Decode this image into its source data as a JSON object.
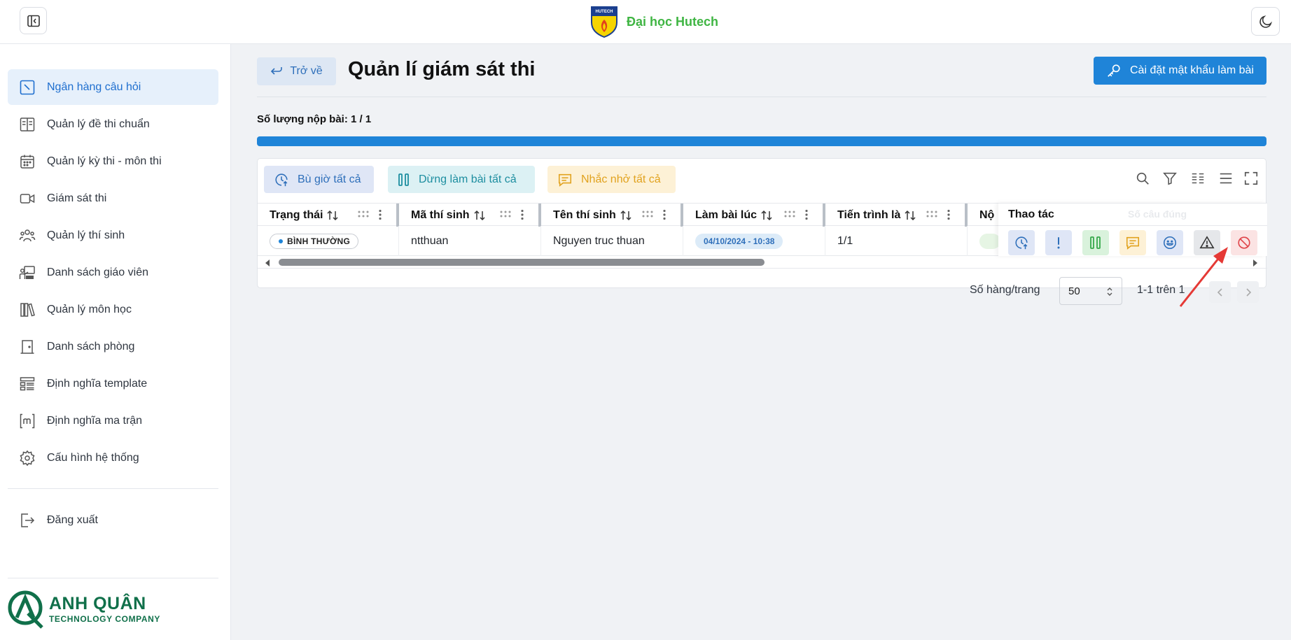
{
  "header": {
    "brand_name": "Đại học Hutech",
    "logo_text": "HUTECH"
  },
  "sidebar": {
    "items": [
      {
        "label": "Ngân hàng câu hỏi",
        "icon": "question-bank-icon",
        "active": true
      },
      {
        "label": "Quản lý đề thi chuẩn",
        "icon": "book-icon"
      },
      {
        "label": "Quản lý kỳ thi - môn thi",
        "icon": "calendar-icon"
      },
      {
        "label": "Giám sát thi",
        "icon": "video-camera-icon"
      },
      {
        "label": "Quản lý thí sinh",
        "icon": "users-icon"
      },
      {
        "label": "Danh sách giáo viên",
        "icon": "teacher-icon"
      },
      {
        "label": "Quản lý môn học",
        "icon": "books-icon"
      },
      {
        "label": "Danh sách phòng",
        "icon": "door-icon"
      },
      {
        "label": "Định nghĩa template",
        "icon": "template-icon"
      },
      {
        "label": "Định nghĩa ma trận",
        "icon": "matrix-icon"
      },
      {
        "label": "Cấu hình hệ thống",
        "icon": "gear-icon"
      }
    ],
    "logout_label": "Đăng xuất",
    "company": {
      "name": "ANH QUÂN",
      "subtitle": "TECHNOLOGY COMPANY"
    }
  },
  "page": {
    "back_label": "Trở về",
    "title": "Quản lí giám sát thi",
    "password_button": "Cài đặt mật khẩu làm bài",
    "submit_count_label": "Số lượng nộp bài: 1 / 1",
    "progress_fraction": 1.0
  },
  "toolbar": {
    "extend_all": "Bù giờ tất cả",
    "stop_all": "Dừng làm bài tất cả",
    "remind_all": "Nhắc nhở tất cả",
    "tools": [
      "search-icon",
      "filter-icon",
      "columns-icon",
      "density-icon",
      "fullscreen-icon"
    ]
  },
  "table": {
    "columns": [
      "Trạng thái",
      "Mã thí sinh",
      "Tên thí sinh",
      "Làm bài lúc",
      "Tiến trình là",
      "Nộ"
    ],
    "pinned_column": "Thao tác",
    "ghost_column": "Số câu đúng",
    "rows": [
      {
        "status": "BÌNH THƯỜNG",
        "code": "ntthuan",
        "name": "Nguyen truc thuan",
        "started_at": "04/10/2024 - 10:38",
        "progress": "1/1"
      }
    ],
    "row_actions": [
      "add-time-icon",
      "exclamation-icon",
      "pause-icon",
      "message-icon",
      "smile-icon",
      "warning-icon",
      "block-icon"
    ]
  },
  "pagination": {
    "rows_label": "Số hàng/trang",
    "rows_value": "50",
    "range_text": "1-1 trên 1"
  },
  "colors": {
    "primary": "#1f84d8",
    "brand_green": "#3fb543",
    "company_green": "#10704a",
    "annotation_red": "#e53935"
  }
}
